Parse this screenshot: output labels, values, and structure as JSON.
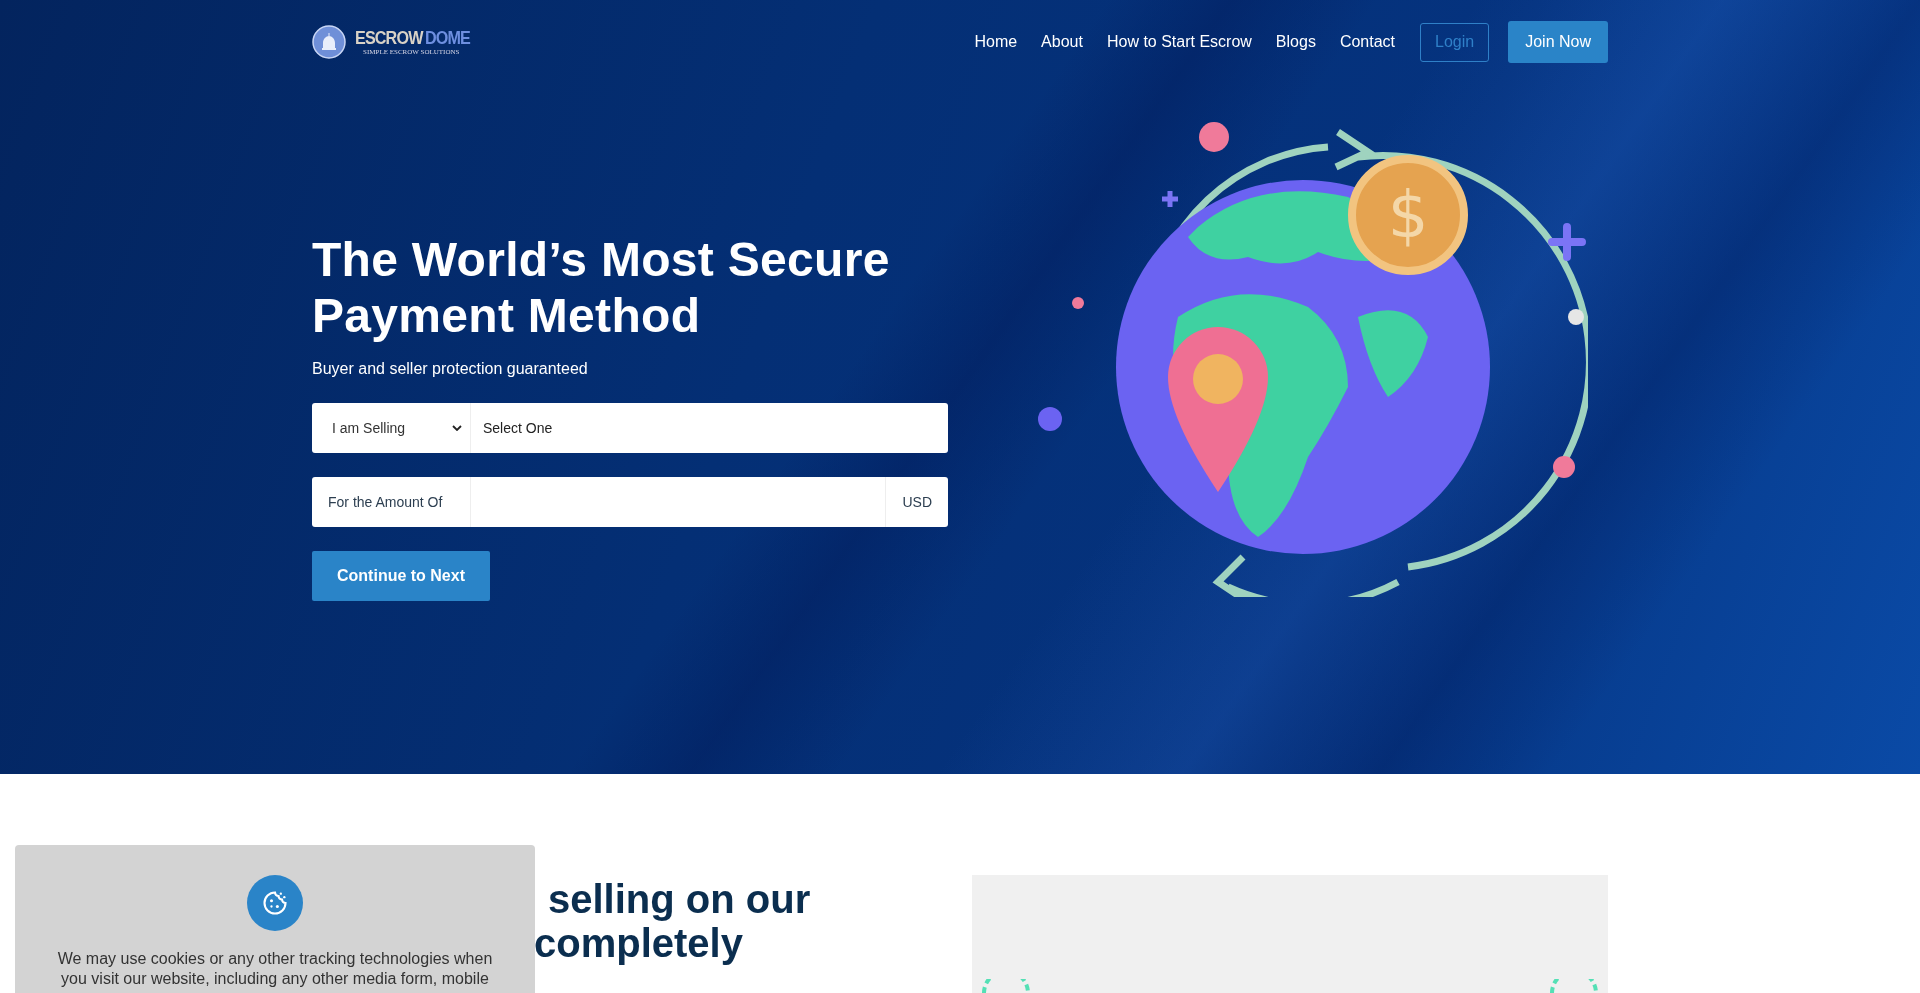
{
  "logo": {
    "word_1": "ESCROW",
    "word_2": "DOME",
    "tagline": "SIMPLE ESCROW SOLUTIONS"
  },
  "nav": {
    "links": [
      "Home",
      "About",
      "How to Start Escrow",
      "Blogs",
      "Contact"
    ],
    "buttons": [
      {
        "label": "Login",
        "kind": "outline"
      },
      {
        "label": "Join Now",
        "kind": "filled"
      }
    ]
  },
  "hero": {
    "title": "The World’s Most Secure Payment Method",
    "subtitle": "Buyer and seller protection guaranteed",
    "role_select": {
      "value": "I am Selling"
    },
    "item_select": {
      "value": "Select One"
    },
    "amount": {
      "label": "For the Amount Of",
      "currency": "USD"
    },
    "submit": "Continue to Next",
    "coin_symbol": "$"
  },
  "section": {
    "heading_lines": [
      "selling on our",
      "completely"
    ]
  },
  "cookie_banner": {
    "text": "We may use cookies or any other tracking technologies when\nyou visit our website, including any other media form, mobile"
  }
}
